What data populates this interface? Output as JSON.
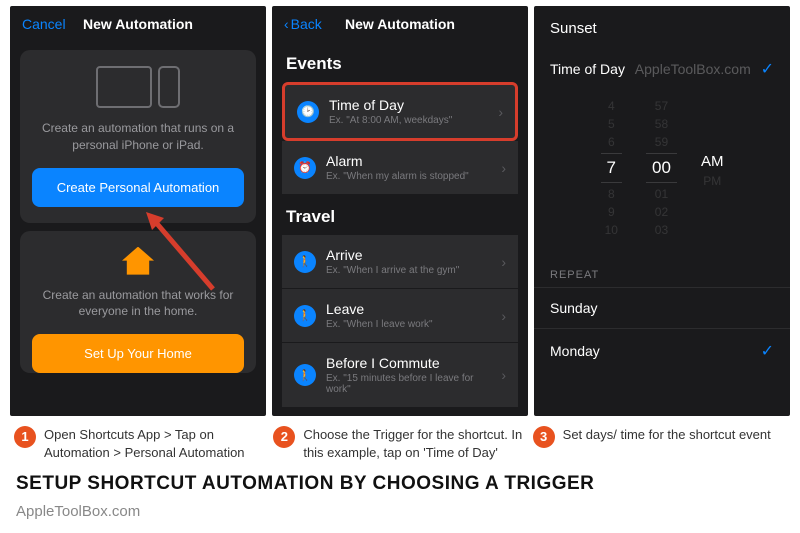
{
  "phone1": {
    "cancel": "Cancel",
    "title": "New Automation",
    "card1_desc": "Create an automation that runs on a personal iPhone or iPad.",
    "card1_btn": "Create Personal Automation",
    "card2_desc": "Create an automation that works for everyone in the home.",
    "card2_btn": "Set Up Your Home"
  },
  "phone2": {
    "back": "Back",
    "title": "New Automation",
    "events_h": "Events",
    "time_title": "Time of Day",
    "time_sub": "Ex. \"At 8:00 AM, weekdays\"",
    "alarm_title": "Alarm",
    "alarm_sub": "Ex. \"When my alarm is stopped\"",
    "travel_h": "Travel",
    "arrive_title": "Arrive",
    "arrive_sub": "Ex. \"When I arrive at the gym\"",
    "leave_title": "Leave",
    "leave_sub": "Ex. \"When I leave work\"",
    "before_title": "Before I Commute",
    "before_sub": "Ex. \"15 minutes before I leave for work\""
  },
  "phone3": {
    "sunset": "Sunset",
    "timeofday": "Time of Day",
    "watermark": "AppleToolBox.com",
    "picker": {
      "hours": [
        "4",
        "5",
        "6",
        "7",
        "8",
        "9",
        "10"
      ],
      "mins": [
        "57",
        "58",
        "59",
        "00",
        "01",
        "02",
        "03"
      ],
      "ampm": [
        "AM",
        "PM"
      ]
    },
    "repeat_h": "Repeat",
    "sunday": "Sunday",
    "monday": "Monday"
  },
  "captions": {
    "c1": "Open Shortcuts App > Tap on Automation > Personal Automation",
    "c2": "Choose the Trigger for the shortcut. In this example, tap on 'Time of Day'",
    "c3": "Set days/ time for the shortcut event"
  },
  "title": "SETUP SHORTCUT AUTOMATION BY CHOOSING A TRIGGER",
  "footer": "AppleToolBox.com",
  "badges": {
    "b1": "1",
    "b2": "2",
    "b3": "3"
  }
}
